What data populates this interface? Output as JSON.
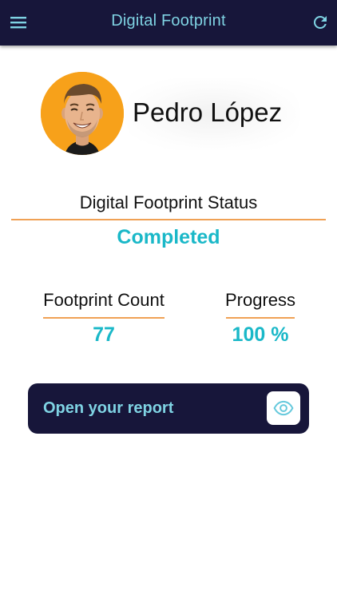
{
  "appbar": {
    "title": "Digital Footprint",
    "menu_icon": "hamburger-menu-icon",
    "refresh_icon": "refresh-icon",
    "background_color": "#17163a",
    "title_color": "#7fd3e3"
  },
  "profile": {
    "name": "Pedro López",
    "avatar_icon": "user-avatar-photo",
    "avatar_background": "#f7a11a"
  },
  "status": {
    "label": "Digital Footprint Status",
    "value": "Completed"
  },
  "stats": {
    "footprint_count": {
      "label": "Footprint Count",
      "value": "77"
    },
    "progress": {
      "label": "Progress",
      "value": "100 %"
    }
  },
  "report_button": {
    "label": "Open your report",
    "icon": "eye-icon"
  },
  "colors": {
    "accent": "#1ab8c8",
    "divider": "#f0a155",
    "dark": "#17163a"
  }
}
